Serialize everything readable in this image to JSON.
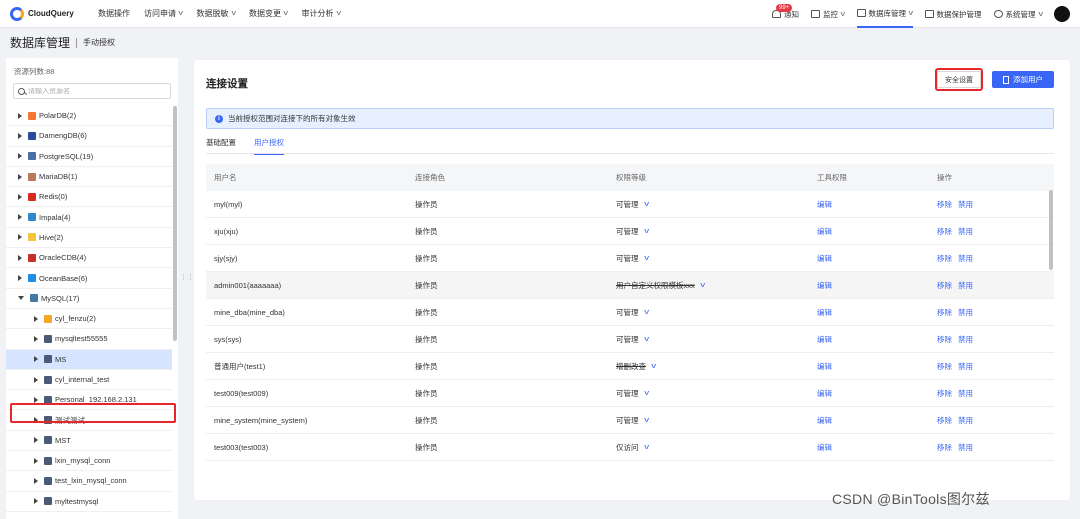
{
  "topbar": {
    "brand": "CloudQuery",
    "menu": [
      {
        "label": "数据操作",
        "dropdown": false
      },
      {
        "label": "访问申请",
        "dropdown": true
      },
      {
        "label": "数据脱敏",
        "dropdown": true
      },
      {
        "label": "数据变更",
        "dropdown": true
      },
      {
        "label": "审计分析",
        "dropdown": true
      }
    ],
    "right": {
      "notice_badge": "99+",
      "notice_label": "通知",
      "monitor": "监控",
      "db_manage": "数据库管理",
      "data_protect": "数据保护管理",
      "system_manage": "系统管理"
    }
  },
  "breadcrumb": {
    "title": "数据库管理",
    "sub": "手动授权"
  },
  "sidebar": {
    "count": "资源列数:88",
    "search_placeholder": "请输入资源名",
    "items": [
      {
        "label": "PolarDB(2)",
        "level": 0,
        "expanded": false,
        "icon": "polardb-icon",
        "color": "#f4772f"
      },
      {
        "label": "DamengDB(6)",
        "level": 0,
        "expanded": false,
        "icon": "dameng-icon",
        "color": "#2b4a9e"
      },
      {
        "label": "PostgreSQL(19)",
        "level": 0,
        "expanded": false,
        "icon": "postgresql-icon",
        "color": "#4a6fa5"
      },
      {
        "label": "MariaDB(1)",
        "level": 0,
        "expanded": false,
        "icon": "mariadb-icon",
        "color": "#c0765a"
      },
      {
        "label": "Redis(0)",
        "level": 0,
        "expanded": false,
        "icon": "redis-icon",
        "color": "#d82c20"
      },
      {
        "label": "Impala(4)",
        "level": 0,
        "expanded": false,
        "icon": "impala-icon",
        "color": "#2d8ac7"
      },
      {
        "label": "Hive(2)",
        "level": 0,
        "expanded": false,
        "icon": "hive-icon",
        "color": "#f2c53d"
      },
      {
        "label": "OracleCDB(4)",
        "level": 0,
        "expanded": false,
        "icon": "oracle-icon",
        "color": "#c7302a"
      },
      {
        "label": "OceanBase(6)",
        "level": 0,
        "expanded": false,
        "icon": "oceanbase-icon",
        "color": "#1f8ce6"
      },
      {
        "label": "MySQL(17)",
        "level": 0,
        "expanded": true,
        "icon": "mysql-icon",
        "color": "#4479a1"
      },
      {
        "label": "cyl_fenzu(2)",
        "level": 1,
        "expanded": false,
        "icon": "folder-icon",
        "color": "#f5a623"
      },
      {
        "label": "mysqltest55555",
        "level": 1,
        "expanded": false,
        "icon": "database-icon",
        "color": "#4a5a78"
      },
      {
        "label": "MS",
        "level": 1,
        "expanded": false,
        "icon": "database-icon",
        "color": "#4a5a78",
        "selected": true
      },
      {
        "label": "cyl_internal_test",
        "level": 1,
        "expanded": false,
        "icon": "database-icon",
        "color": "#4a5a78"
      },
      {
        "label": "Personal_192.168.2.131",
        "level": 1,
        "expanded": false,
        "icon": "database-icon",
        "color": "#4a5a78"
      },
      {
        "label": "测试测试",
        "level": 1,
        "expanded": false,
        "icon": "database-icon",
        "color": "#4a5a78"
      },
      {
        "label": "MST",
        "level": 1,
        "expanded": false,
        "icon": "database-icon",
        "color": "#4a5a78"
      },
      {
        "label": "lxin_mysql_conn",
        "level": 1,
        "expanded": false,
        "icon": "database-icon",
        "color": "#4a5a78"
      },
      {
        "label": "test_lxin_mysql_conn",
        "level": 1,
        "expanded": false,
        "icon": "database-icon",
        "color": "#4a5a78"
      },
      {
        "label": "myltestmysql",
        "level": 1,
        "expanded": false,
        "icon": "database-icon",
        "color": "#4a5a78"
      }
    ]
  },
  "main": {
    "title": "连接设置",
    "security_button": "安全设置",
    "add_user_button": "添加用户",
    "info": "当前授权范围对连接下的所有对象生效",
    "tabs": [
      {
        "label": "基础配置",
        "active": false
      },
      {
        "label": "用户授权",
        "active": true
      }
    ],
    "columns": [
      "用户名",
      "连接角色",
      "权限等级",
      "工具权限",
      "操作"
    ],
    "rows": [
      {
        "user": "myl(myl)",
        "role": "操作员",
        "level": "可管理",
        "tool": "编辑",
        "act1": "移除",
        "act2": "禁用",
        "strike": false
      },
      {
        "user": "xju(xju)",
        "role": "操作员",
        "level": "可管理",
        "tool": "编辑",
        "act1": "移除",
        "act2": "禁用",
        "strike": false
      },
      {
        "user": "sjy(sjy)",
        "role": "操作员",
        "level": "可管理",
        "tool": "编辑",
        "act1": "移除",
        "act2": "禁用",
        "strike": false
      },
      {
        "user": "admin001(aaaaaaa)",
        "role": "操作员",
        "level": "用户自定义权限模板xxx",
        "tool": "编辑",
        "act1": "移除",
        "act2": "禁用",
        "strike": true
      },
      {
        "user": "mine_dba(mine_dba)",
        "role": "操作员",
        "level": "可管理",
        "tool": "编辑",
        "act1": "移除",
        "act2": "禁用",
        "strike": false
      },
      {
        "user": "sys(sys)",
        "role": "操作员",
        "level": "可管理",
        "tool": "编辑",
        "act1": "移除",
        "act2": "禁用",
        "strike": false
      },
      {
        "user": "普通用户(test1)",
        "role": "操作员",
        "level": "增删改查",
        "tool": "编辑",
        "act1": "移除",
        "act2": "禁用",
        "strike": true
      },
      {
        "user": "test009(test009)",
        "role": "操作员",
        "level": "可管理",
        "tool": "编辑",
        "act1": "移除",
        "act2": "禁用",
        "strike": false
      },
      {
        "user": "mine_system(mine_system)",
        "role": "操作员",
        "level": "可管理",
        "tool": "编辑",
        "act1": "移除",
        "act2": "禁用",
        "strike": false
      },
      {
        "user": "test003(test003)",
        "role": "操作员",
        "level": "仅访问",
        "tool": "编辑",
        "act1": "移除",
        "act2": "禁用",
        "strike": false
      }
    ]
  },
  "watermark": "CSDN @BinTools图尔兹",
  "colors": {
    "accent": "#3a66f5",
    "highlight": "#e8262a",
    "selected_row": "#d6e4ff"
  }
}
